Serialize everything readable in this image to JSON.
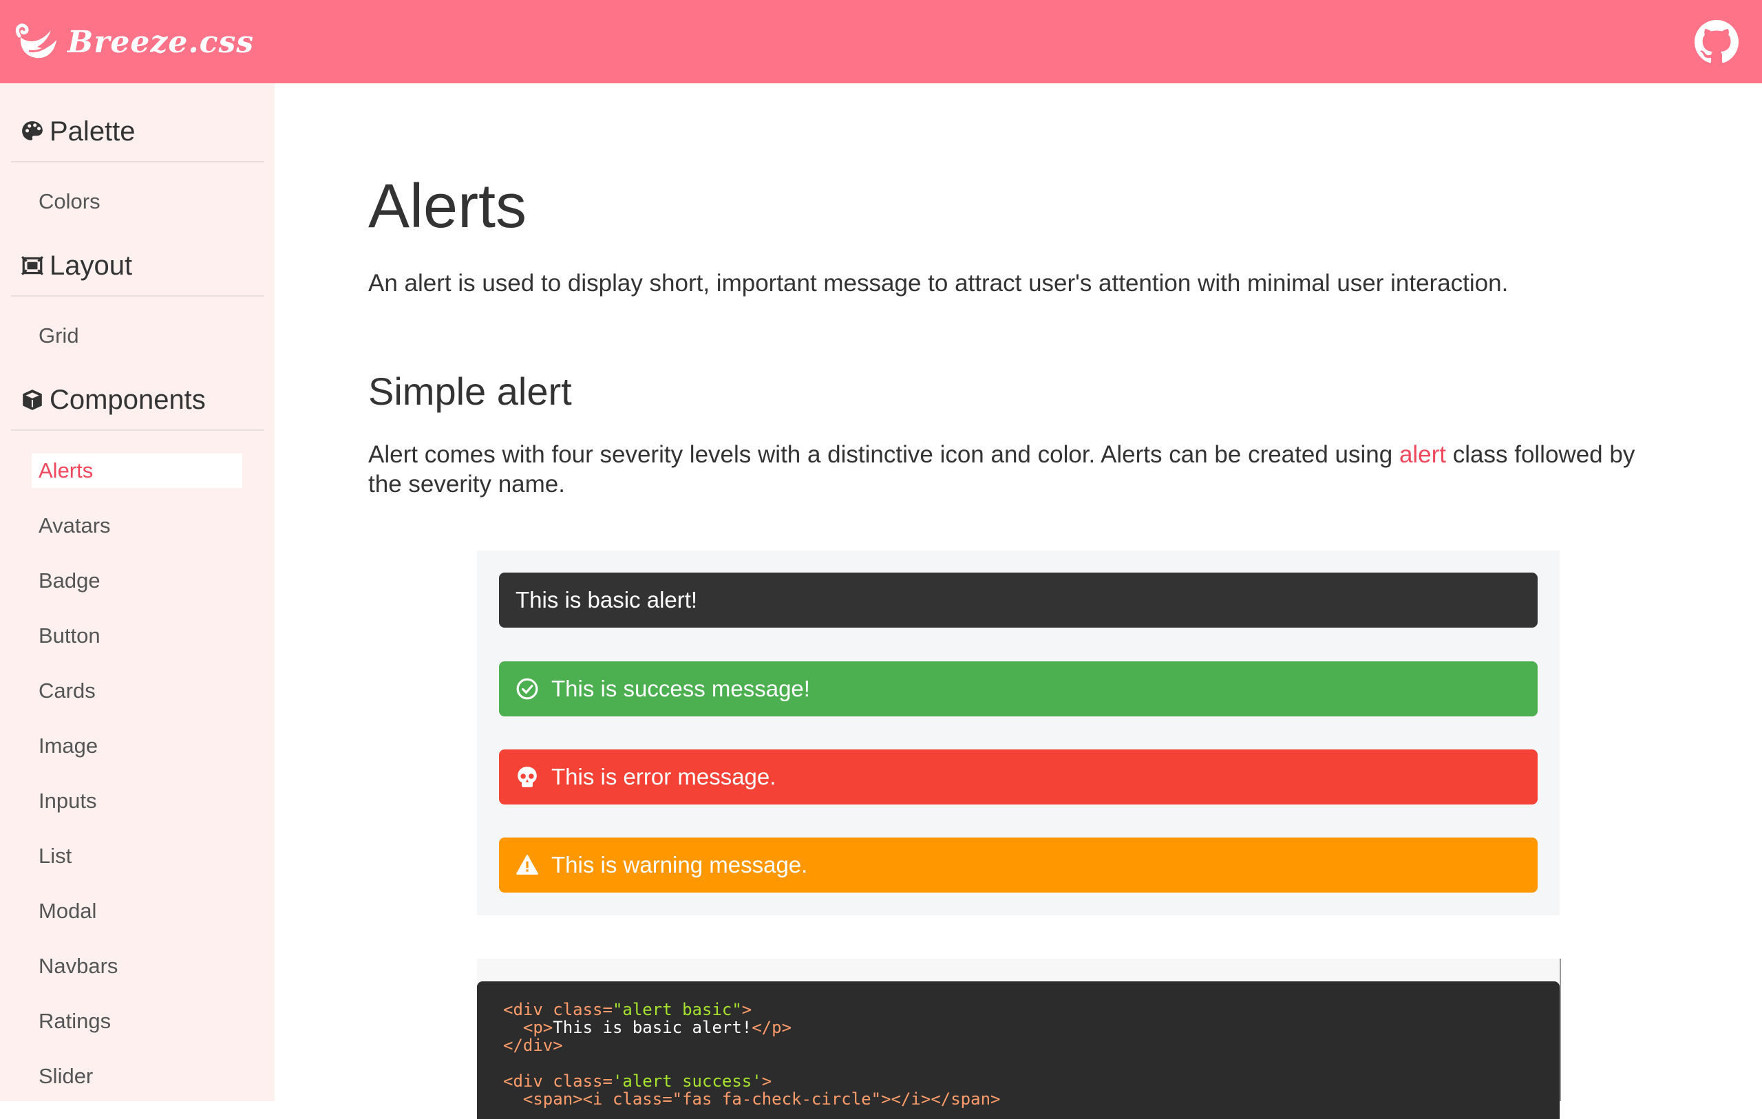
{
  "header": {
    "brand": "Breeze.css",
    "colors": {
      "bar": "#ff7388"
    }
  },
  "sidebar": {
    "sections": [
      {
        "heading": "Palette",
        "icon": "palette-icon",
        "items": [
          "Colors"
        ]
      },
      {
        "heading": "Layout",
        "icon": "layout-icon",
        "items": [
          "Grid"
        ]
      },
      {
        "heading": "Components",
        "icon": "cube-icon",
        "items": [
          "Alerts",
          "Avatars",
          "Badge",
          "Button",
          "Cards",
          "Image",
          "Inputs",
          "List",
          "Modal",
          "Navbars",
          "Ratings",
          "Slider"
        ]
      }
    ],
    "active": "Alerts"
  },
  "main": {
    "title": "Alerts",
    "lead": "An alert is used to display short, important message to attract user's attention with minimal user interaction.",
    "section_title": "Simple alert",
    "desc_before": "Alert comes with four severity levels with a distinctive icon and color. Alerts can be created using ",
    "desc_highlight": "alert",
    "desc_after": " class followed by the severity name.",
    "alerts": [
      {
        "text": "This is basic alert!",
        "color": "#333333"
      },
      {
        "text": "This is success message!",
        "icon": "check-circle-icon",
        "color": "#4caf50"
      },
      {
        "text": "This is error message.",
        "icon": "skull-icon",
        "color": "#f44336"
      },
      {
        "text": "This is warning message.",
        "icon": "warning-icon",
        "color": "#ff9800"
      }
    ],
    "code": {
      "l1_open": "<div ",
      "l1_attr": "class=",
      "l1_val": "\"alert basic\"",
      "l1_close": ">",
      "l2_open": "  <p>",
      "l2_text": "This is basic alert!",
      "l2_close": "</p>",
      "l3": "</div>",
      "l5_open": "<div ",
      "l5_attr": "class=",
      "l5_val": "'alert success'",
      "l5_close": ">",
      "l6": "  <span><i class=\"fas fa-check-circle\"></i></span>"
    }
  }
}
